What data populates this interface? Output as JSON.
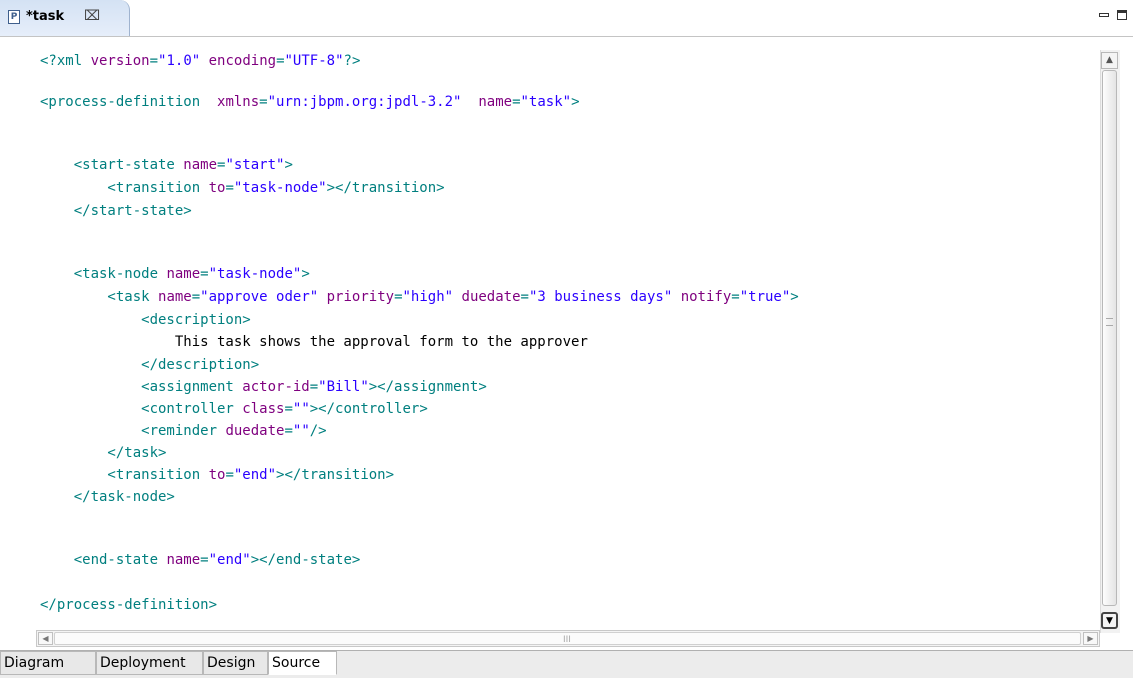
{
  "editor_tab": {
    "icon": "P",
    "title": "*task",
    "close_glyph": "⌧"
  },
  "source_lines": [
    [
      {
        "c": "t",
        "s": "<?xml "
      },
      {
        "c": "a",
        "s": "version"
      },
      {
        "c": "t",
        "s": "="
      },
      {
        "c": "v",
        "s": "\"1.0\""
      },
      {
        "c": "t",
        "s": " "
      },
      {
        "c": "a",
        "s": "encoding"
      },
      {
        "c": "t",
        "s": "="
      },
      {
        "c": "v",
        "s": "\"UTF-8\""
      },
      {
        "c": "t",
        "s": "?>"
      }
    ],
    [
      {
        "c": "t",
        "s": "<process-definition  "
      },
      {
        "c": "a",
        "s": "xmlns"
      },
      {
        "c": "t",
        "s": "="
      },
      {
        "c": "v",
        "s": "\"urn:jbpm.org:jpdl-3.2\""
      },
      {
        "c": "t",
        "s": "  "
      },
      {
        "c": "a",
        "s": "name"
      },
      {
        "c": "t",
        "s": "="
      },
      {
        "c": "v",
        "s": "\"task\""
      },
      {
        "c": "t",
        "s": ">"
      }
    ],
    [
      {
        "c": "t",
        "s": "    <start-state "
      },
      {
        "c": "a",
        "s": "name"
      },
      {
        "c": "t",
        "s": "="
      },
      {
        "c": "v",
        "s": "\"start\""
      },
      {
        "c": "t",
        "s": ">"
      }
    ],
    [
      {
        "c": "t",
        "s": "        <transition "
      },
      {
        "c": "a",
        "s": "to"
      },
      {
        "c": "t",
        "s": "="
      },
      {
        "c": "v",
        "s": "\"task-node\""
      },
      {
        "c": "t",
        "s": "></transition>"
      }
    ],
    [
      {
        "c": "t",
        "s": "    </start-state>"
      }
    ],
    [
      {
        "c": "t",
        "s": "    <task-node "
      },
      {
        "c": "a",
        "s": "name"
      },
      {
        "c": "t",
        "s": "="
      },
      {
        "c": "v",
        "s": "\"task-node\""
      },
      {
        "c": "t",
        "s": ">"
      }
    ],
    [
      {
        "c": "t",
        "s": "        <task "
      },
      {
        "c": "a",
        "s": "name"
      },
      {
        "c": "t",
        "s": "="
      },
      {
        "c": "v",
        "s": "\"approve oder\""
      },
      {
        "c": "t",
        "s": " "
      },
      {
        "c": "a",
        "s": "priority"
      },
      {
        "c": "t",
        "s": "="
      },
      {
        "c": "v",
        "s": "\"high\""
      },
      {
        "c": "t",
        "s": " "
      },
      {
        "c": "a",
        "s": "duedate"
      },
      {
        "c": "t",
        "s": "="
      },
      {
        "c": "v",
        "s": "\"3 business days\""
      },
      {
        "c": "t",
        "s": " "
      },
      {
        "c": "a",
        "s": "notify"
      },
      {
        "c": "t",
        "s": "="
      },
      {
        "c": "v",
        "s": "\"true\""
      },
      {
        "c": "t",
        "s": ">"
      }
    ],
    [
      {
        "c": "t",
        "s": "            <description>"
      }
    ],
    [
      {
        "c": "p",
        "s": "                This task shows the approval form to the approver"
      }
    ],
    [
      {
        "c": "t",
        "s": "            </description>"
      }
    ],
    [
      {
        "c": "t",
        "s": "            <assignment "
      },
      {
        "c": "a",
        "s": "actor-id"
      },
      {
        "c": "t",
        "s": "="
      },
      {
        "c": "v",
        "s": "\"Bill\""
      },
      {
        "c": "t",
        "s": "></assignment>"
      }
    ],
    [
      {
        "c": "t",
        "s": "            <controller "
      },
      {
        "c": "a",
        "s": "class"
      },
      {
        "c": "t",
        "s": "="
      },
      {
        "c": "v",
        "s": "\"\""
      },
      {
        "c": "t",
        "s": "></controller>"
      }
    ],
    [
      {
        "c": "t",
        "s": "            <reminder "
      },
      {
        "c": "a",
        "s": "duedate"
      },
      {
        "c": "t",
        "s": "="
      },
      {
        "c": "v",
        "s": "\"\""
      },
      {
        "c": "t",
        "s": "/>"
      }
    ],
    [
      {
        "c": "t",
        "s": "        </task>"
      }
    ],
    [
      {
        "c": "t",
        "s": "        <transition "
      },
      {
        "c": "a",
        "s": "to"
      },
      {
        "c": "t",
        "s": "="
      },
      {
        "c": "v",
        "s": "\"end\""
      },
      {
        "c": "t",
        "s": "></transition>"
      }
    ],
    [
      {
        "c": "t",
        "s": "    </task-node>"
      }
    ],
    [
      {
        "c": "t",
        "s": "    <end-state "
      },
      {
        "c": "a",
        "s": "name"
      },
      {
        "c": "t",
        "s": "="
      },
      {
        "c": "v",
        "s": "\"end\""
      },
      {
        "c": "t",
        "s": "></end-state>"
      }
    ],
    [
      {
        "c": "t",
        "s": "</process-definition>"
      }
    ]
  ],
  "bottom_tabs": [
    {
      "label": "Diagram",
      "active": false
    },
    {
      "label": "Deployment",
      "active": false
    },
    {
      "label": "Design",
      "active": false
    },
    {
      "label": "Source",
      "active": true
    }
  ],
  "scrollbar_grip": "III"
}
